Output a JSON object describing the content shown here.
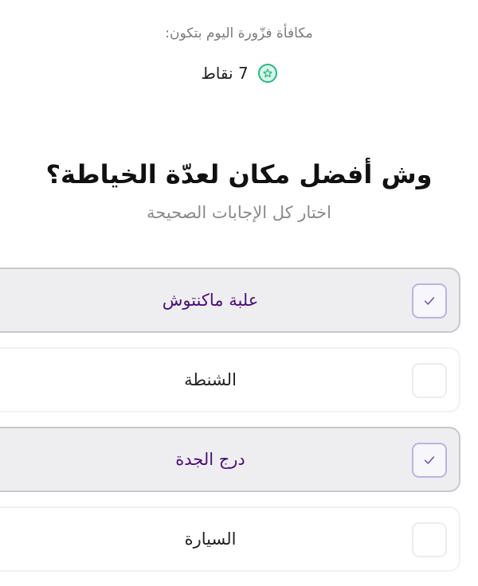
{
  "reward": {
    "label": "مكافأة فزّورة اليوم بتكون:",
    "value": "7 نقاط",
    "icon": "star-badge-icon",
    "icon_color": "#26b886"
  },
  "question": {
    "title": "وش أفضل مكان لعدّة الخياطة؟",
    "subtitle": "اختار كل الإجابات الصحيحة"
  },
  "options": [
    {
      "label": "علبة ماكنتوش",
      "selected": true
    },
    {
      "label": "الشنطة",
      "selected": false
    },
    {
      "label": "درج الجدة",
      "selected": true
    },
    {
      "label": "السيارة",
      "selected": false
    }
  ],
  "colors": {
    "selected_text": "#4a0e7a",
    "check_mark": "#5a55a8"
  }
}
